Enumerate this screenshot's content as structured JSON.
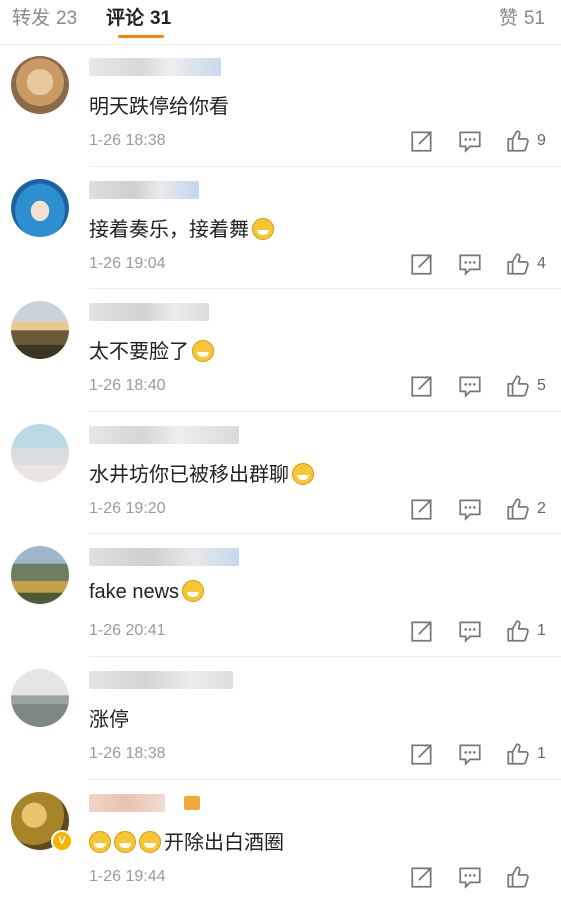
{
  "tabs": {
    "reposts": {
      "label": "转发",
      "count": "23"
    },
    "comments": {
      "label": "评论",
      "count": "31"
    },
    "likes": {
      "label": "赞",
      "count": "51"
    }
  },
  "comments": [
    {
      "text": "明天跌停给你看",
      "emoji": "",
      "time": "1-26 18:38",
      "likes": "9"
    },
    {
      "text": "接着奏乐，接着舞",
      "emoji": "grin",
      "time": "1-26 19:04",
      "likes": "4"
    },
    {
      "text": "太不要脸了",
      "emoji": "laugh-cry",
      "time": "1-26 18:40",
      "likes": "5"
    },
    {
      "text": "水井坊你已被移出群聊",
      "emoji": "laugh-cry",
      "time": "1-26 19:20",
      "likes": "2"
    },
    {
      "text": "fake news",
      "emoji": "laugh-cry",
      "time": "1-26 20:41",
      "likes": "1"
    },
    {
      "text": "涨停",
      "emoji": "",
      "time": "1-26 18:38",
      "likes": "1"
    },
    {
      "text": "开除出白酒圈",
      "emoji": "pleading x3",
      "time": "1-26 19:44",
      "likes": ""
    }
  ],
  "icons": {
    "repost": "repost-icon",
    "reply": "reply-icon",
    "like": "thumbs-up-icon",
    "verified": "verified-badge-icon"
  },
  "colors": {
    "accent": "#ff8200",
    "time": "#9a9a9a",
    "text": "#222222"
  }
}
